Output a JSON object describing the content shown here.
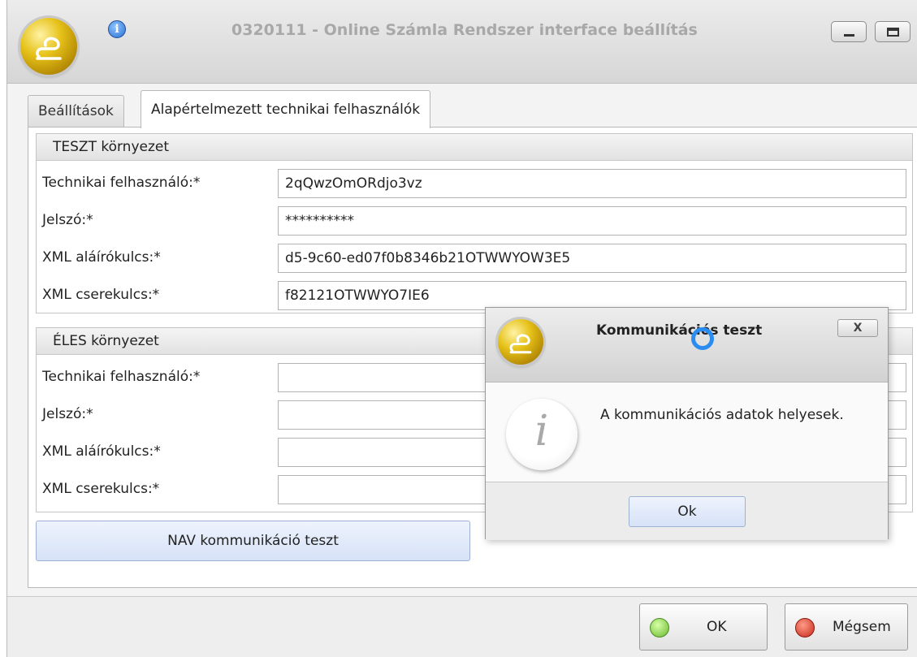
{
  "window": {
    "title": "0320111 - Online Számla Rendszer interface beállítás",
    "info_glyph": "i",
    "icons": [
      "app-logo-icon",
      "info-icon",
      "minimize-icon",
      "maximize-icon"
    ]
  },
  "tabs": [
    {
      "label": "Beállítások",
      "active": false
    },
    {
      "label": "Alapértelmezett technikai felhasználók",
      "active": true
    }
  ],
  "teszt": {
    "header": "TESZT környezet",
    "rows": [
      {
        "label": "Technikai felhasználó:*",
        "value": "2qQwzOmORdjo3vz"
      },
      {
        "label": "Jelszó:*",
        "value": "**********"
      },
      {
        "label": "XML aláírókulcs:*",
        "value": "d5-9c60-ed07f0b8346b21OTWWYOW3E5"
      },
      {
        "label": "XML cserekulcs:*",
        "value": "f82121OTWWYO7IE6"
      }
    ]
  },
  "eles": {
    "header": "ÉLES környezet",
    "rows": [
      {
        "label": "Technikai felhasználó:*",
        "value": ""
      },
      {
        "label": "Jelszó:*",
        "value": ""
      },
      {
        "label": "XML aláírókulcs:*",
        "value": ""
      },
      {
        "label": "XML cserekulcs:*",
        "value": ""
      }
    ]
  },
  "nav_test_button": "NAV kommunikáció teszt",
  "footer": {
    "ok_label": "OK",
    "cancel_label": "Mégsem"
  },
  "dialog": {
    "title": "Kommunikációs teszt",
    "close_glyph": "X",
    "message": "A kommunikációs adatok helyesek.",
    "ok_label": "Ok",
    "info_glyph": "i"
  },
  "colors": {
    "accent_blue": "#2a8cf0",
    "button_blue": "#d6e2f7",
    "logo_gold": "#e6c219"
  }
}
